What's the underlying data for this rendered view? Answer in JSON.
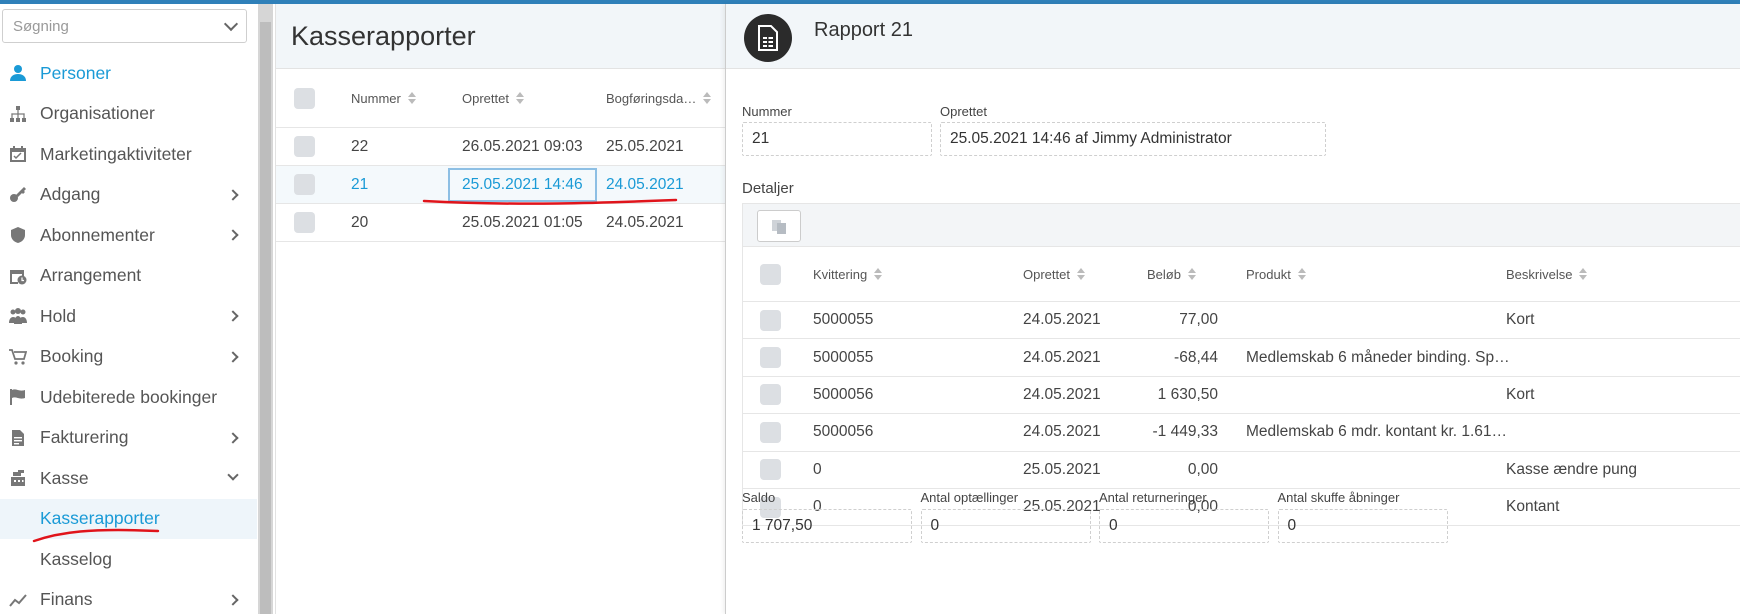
{
  "search": {
    "placeholder": "Søgning"
  },
  "nav": {
    "items": [
      {
        "label": "Personer",
        "icon": "person-icon",
        "active": true,
        "arrow": ""
      },
      {
        "label": "Organisationer",
        "icon": "org-chart-icon",
        "arrow": ""
      },
      {
        "label": "Marketingaktiviteter",
        "icon": "calendar-check-icon",
        "arrow": ""
      },
      {
        "label": "Adgang",
        "icon": "key-icon",
        "arrow": "right"
      },
      {
        "label": "Abonnementer",
        "icon": "shield-icon",
        "arrow": "right"
      },
      {
        "label": "Arrangement",
        "icon": "calendar-clock-icon",
        "arrow": ""
      },
      {
        "label": "Hold",
        "icon": "group-icon",
        "arrow": "right"
      },
      {
        "label": "Booking",
        "icon": "cart-icon",
        "arrow": "right"
      },
      {
        "label": "Udebiterede bookinger",
        "icon": "flag-icon",
        "arrow": ""
      },
      {
        "label": "Fakturering",
        "icon": "document-icon",
        "arrow": "right"
      },
      {
        "label": "Kasse",
        "icon": "cash-register-icon",
        "arrow": "down"
      }
    ],
    "sub_items": [
      "Kasserapporter",
      "Kasselog"
    ],
    "after": {
      "label": "Finans",
      "icon": "trend-icon",
      "arrow": "right"
    }
  },
  "list": {
    "title": "Kasserapporter",
    "columns": [
      "Nummer",
      "Oprettet",
      "Bogføringsda…"
    ],
    "rows": [
      {
        "nummer": "22",
        "oprettet": "26.05.2021 09:03",
        "bogforing": "25.05.2021"
      },
      {
        "nummer": "21",
        "oprettet": "25.05.2021 14:46",
        "bogforing": "24.05.2021"
      },
      {
        "nummer": "20",
        "oprettet": "25.05.2021 01:05",
        "bogforing": "24.05.2021"
      }
    ]
  },
  "report": {
    "title": "Rapport 21",
    "nummer_label": "Nummer",
    "nummer_value": "21",
    "oprettet_label": "Oprettet",
    "oprettet_value": "25.05.2021 14:46 af Jimmy Administrator",
    "details_title": "Detaljer",
    "columns": [
      "Kvittering",
      "Oprettet",
      "Beløb",
      "Produkt",
      "Beskrivelse"
    ],
    "rows": [
      {
        "kvittering": "5000055",
        "oprettet": "24.05.2021",
        "belob": "77,00",
        "produkt": "",
        "beskrivelse": "Kort"
      },
      {
        "kvittering": "5000055",
        "oprettet": "24.05.2021",
        "belob": "-68,44",
        "produkt": "Medlemskab 6 måneder binding. Sp…",
        "beskrivelse": ""
      },
      {
        "kvittering": "5000056",
        "oprettet": "24.05.2021",
        "belob": "1 630,50",
        "produkt": "",
        "beskrivelse": "Kort"
      },
      {
        "kvittering": "5000056",
        "oprettet": "24.05.2021",
        "belob": "-1 449,33",
        "produkt": "Medlemskab 6 mdr. kontant kr. 1.61…",
        "beskrivelse": ""
      },
      {
        "kvittering": "0",
        "oprettet": "25.05.2021",
        "belob": "0,00",
        "produkt": "",
        "beskrivelse": "Kasse ændre pung"
      },
      {
        "kvittering": "0",
        "oprettet": "25.05.2021",
        "belob": "0,00",
        "produkt": "",
        "beskrivelse": "Kontant"
      }
    ],
    "summary": [
      {
        "label": "Saldo",
        "value": "1 707,50"
      },
      {
        "label": "Antal optællinger",
        "value": "0"
      },
      {
        "label": "Antal returneringer",
        "value": "0"
      },
      {
        "label": "Antal skuffe åbninger",
        "value": "0"
      }
    ]
  },
  "colors": {
    "accent": "#1a9ad6",
    "topbar": "#2f80b9",
    "annotation": "#e0141b"
  }
}
